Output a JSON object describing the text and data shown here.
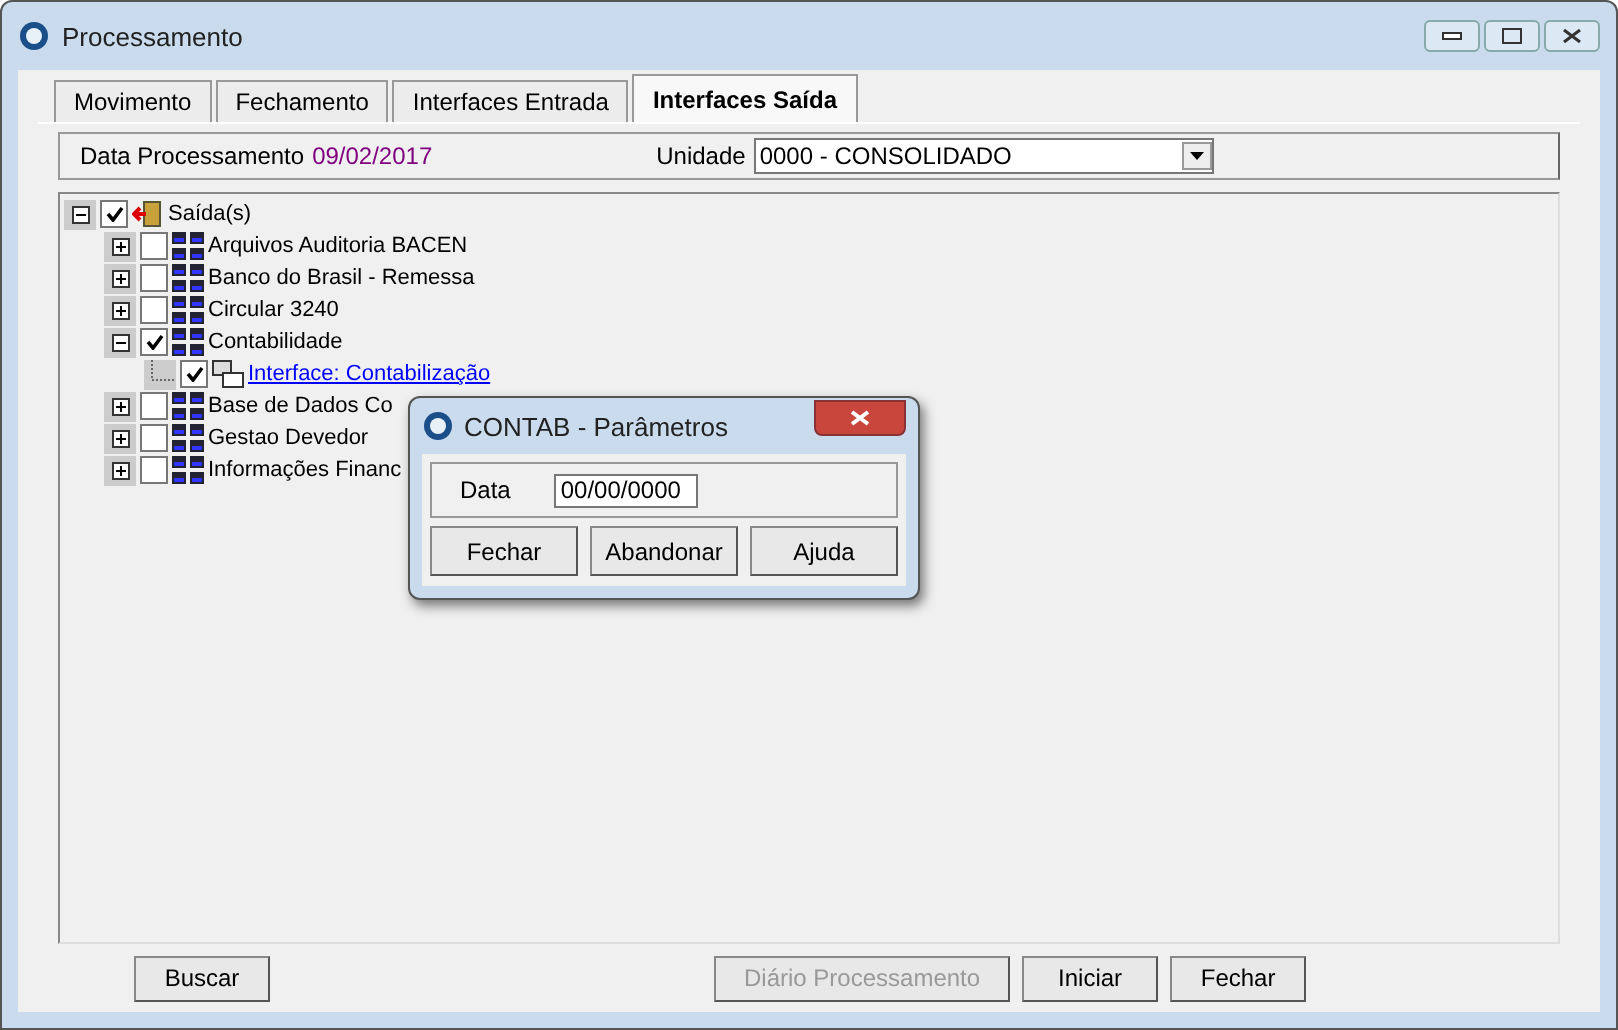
{
  "window": {
    "title": "Processamento"
  },
  "tabs": [
    {
      "label": "Movimento",
      "selected": false
    },
    {
      "label": "Fechamento",
      "selected": false
    },
    {
      "label": "Interfaces Entrada",
      "selected": false
    },
    {
      "label": "Interfaces Saída",
      "selected": true
    }
  ],
  "header": {
    "date_label": "Data Processamento",
    "date_value": "09/02/2017",
    "unit_label": "Unidade",
    "unit_value": "0000 - CONSOLIDADO"
  },
  "tree": [
    {
      "label": "Saída(s)",
      "kind": "root",
      "checked": true,
      "expanded": true,
      "children": [
        {
          "label": "Arquivos Auditoria BACEN",
          "kind": "group",
          "checked": false,
          "expanded": false
        },
        {
          "label": "Banco do Brasil - Remessa",
          "kind": "group",
          "checked": false,
          "expanded": false
        },
        {
          "label": "Circular 3240",
          "kind": "group",
          "checked": false,
          "expanded": false
        },
        {
          "label": "Contabilidade",
          "kind": "group",
          "checked": true,
          "expanded": true,
          "children": [
            {
              "label": "Interface: Contabilização",
              "kind": "link",
              "checked": true
            }
          ]
        },
        {
          "label": "Base de Dados Co",
          "kind": "group",
          "checked": false,
          "expanded": false
        },
        {
          "label": "Gestao Devedor",
          "kind": "group",
          "checked": false,
          "expanded": false
        },
        {
          "label": "Informações Financ",
          "kind": "group",
          "checked": false,
          "expanded": false
        }
      ]
    }
  ],
  "buttons": [
    {
      "label": "Buscar",
      "disabled": false
    },
    {
      "label": "Diário Processamento",
      "disabled": true
    },
    {
      "label": "Iniciar",
      "disabled": false
    },
    {
      "label": "Fechar",
      "disabled": false
    }
  ],
  "dialog": {
    "title": "CONTAB - Parâmetros",
    "field_label": "Data",
    "field_value": "00/00/0000",
    "buttons": [
      "Fechar",
      "Abandonar",
      "Ajuda"
    ]
  }
}
